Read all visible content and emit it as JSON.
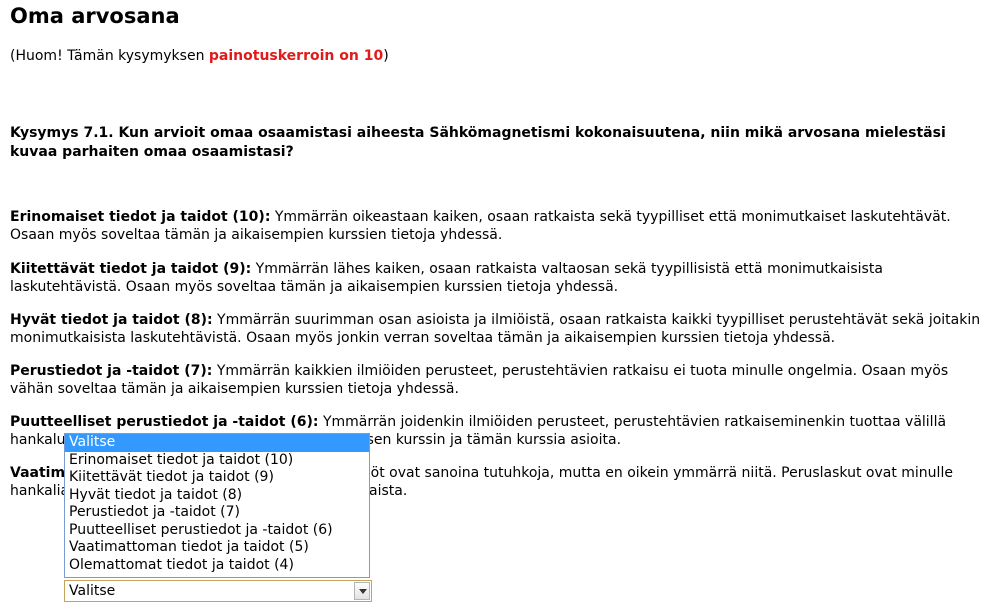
{
  "page": {
    "title": "Oma arvosana",
    "note_prefix": "(Huom! Tämän kysymyksen ",
    "note_highlight": "painotuskerroin on 10",
    "note_suffix": ")"
  },
  "question": {
    "text": "Kysymys 7.1. Kun arvioit omaa osaamistasi aiheesta Sähkömagnetismi kokonaisuutena, niin mikä arvosana mielestäsi kuvaa parhaiten omaa osaamistasi?"
  },
  "criteria": [
    {
      "title": "Erinomaiset tiedot ja taidot (10):",
      "text": " Ymmärrän oikeastaan kaiken, osaan ratkaista sekä tyypilliset että monimutkaiset laskutehtävät. Osaan myös soveltaa tämän ja aikaisempien kurssien tietoja yhdessä."
    },
    {
      "title": "Kiitettävät tiedot ja taidot (9):",
      "text": " Ymmärrän lähes kaiken, osaan ratkaista valtaosan sekä tyypillisistä että monimutkaisista laskutehtävistä. Osaan myös soveltaa tämän ja aikaisempien kurssien tietoja yhdessä."
    },
    {
      "title": "Hyvät tiedot ja taidot (8):",
      "text": " Ymmärrän suurimman osan asioista ja ilmiöistä, osaan ratkaista kaikki tyypilliset perustehtävät sekä joitakin monimutkaisista laskutehtävistä. Osaan myös jonkin verran soveltaa tämän ja aikaisempien kurssien tietoja yhdessä."
    },
    {
      "title": "Perustiedot ja -taidot (7):",
      "text": " Ymmärrän kaikkien ilmiöiden perusteet, perustehtävien ratkaisu ei tuota minulle ongelmia. Osaan myös vähän soveltaa tämän ja aikaisempien kurssien tietoja yhdessä."
    },
    {
      "title": "Puutteelliset perustiedot ja -taidot (6):",
      "text": " Ymmärrän joidenkin ilmiöiden perusteet, perustehtävien ratkaiseminenkin tuottaa välillä hankaluuksia. Osaan jonkin verran yhdistellä edellisen kurssin ja tämän kurssia asioita."
    },
    {
      "title": "Vaatimattomat tiedot ja taidot (5):",
      "text": " Asiat ja ilmiöt ovat sanoina tutuhkoja, mutta en oikein ymmärrä niitä. Peruslaskut ovat minulle hankalia, enkä juurikaan ilman apua osaa niitä ratkaista."
    }
  ],
  "grade_select": {
    "selected": "Valitse",
    "options": [
      "Valitse",
      "Erinomaiset tiedot ja taidot (10)",
      "Kiitettävät tiedot ja taidot (9)",
      "Hyvät tiedot ja taidot (8)",
      "Perustiedot ja -taidot (7)",
      "Puutteelliset perustiedot ja -taidot (6)",
      "Vaatimattoman tiedot ja taidot (5)",
      "Olemattomat tiedot ja taidot (4)"
    ],
    "highlighted_index": 0
  }
}
